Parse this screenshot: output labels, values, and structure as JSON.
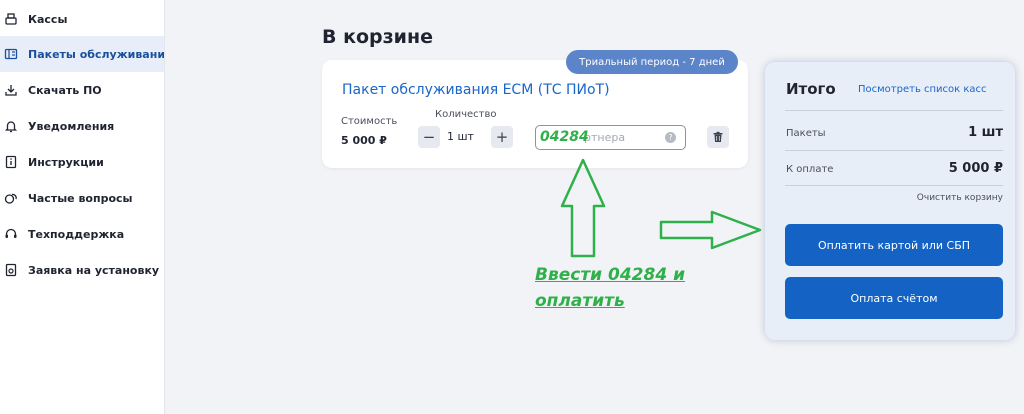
{
  "sidebar": {
    "items": [
      {
        "label": "Кассы",
        "icon": "cash-register-icon"
      },
      {
        "label": "Пакеты обслуживания",
        "icon": "package-icon",
        "active": true
      },
      {
        "label": "Скачать ПО",
        "icon": "download-icon"
      },
      {
        "label": "Уведомления",
        "icon": "bell-icon"
      },
      {
        "label": "Инструкции",
        "icon": "info-doc-icon"
      },
      {
        "label": "Частые вопросы",
        "icon": "faq-icon"
      },
      {
        "label": "Техподдержка",
        "icon": "headset-icon"
      },
      {
        "label": "Заявка на установку",
        "icon": "request-doc-icon"
      }
    ]
  },
  "cart": {
    "title": "В корзине",
    "badge": "Триальный период - 7 дней",
    "package_name": "Пакет обслуживания ECM (ТС ПИоТ)",
    "cost_label": "Стоимость",
    "cost_value": "5 000 ₽",
    "qty_label": "Количество",
    "qty_minus": "−",
    "qty_value": "1 шт",
    "qty_plus": "+",
    "partner_placeholder": "ртнера",
    "help": "?"
  },
  "annotation": {
    "code": "04284",
    "text": "Ввести 04284 и оплатить",
    "color": "#2fb04a"
  },
  "summary": {
    "title": "Итого",
    "view_list_link": "Посмотреть список касс",
    "packages_label": "Пакеты",
    "packages_value": "1 шт",
    "to_pay_label": "К оплате",
    "to_pay_value": "5 000 ₽",
    "clear_cart": "Очистить корзину",
    "pay_card_button": "Оплатить картой или СБП",
    "pay_invoice_button": "Оплата счётом"
  },
  "colors": {
    "accent": "#1463c4",
    "link": "#1a66c9",
    "badge": "#5b84c9",
    "background": "#f2f3f6"
  }
}
